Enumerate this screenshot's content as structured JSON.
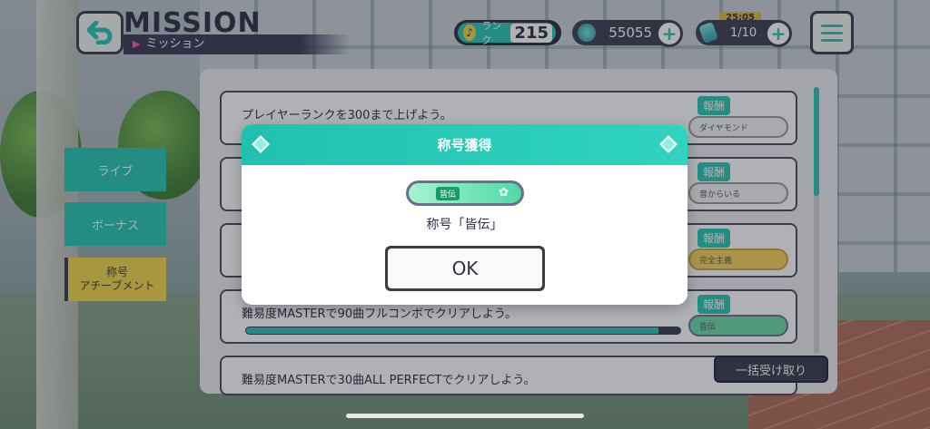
{
  "header": {
    "title": "MISSION",
    "subtitle": "ミッション"
  },
  "status": {
    "rank_label": "ランク",
    "rank_value": "215",
    "gems": "55055",
    "energy": "1/10",
    "energy_timer": "25:05"
  },
  "tabs": [
    {
      "label": "ライブ"
    },
    {
      "label": "ボーナス"
    },
    {
      "label": "称号\nアチーブメント"
    }
  ],
  "missions": [
    {
      "text": "プレイヤーランクを300まで上げよう。",
      "reward_tag": "報酬",
      "reward": "ダイヤモンド"
    },
    {
      "text": "",
      "reward_tag": "報酬",
      "reward": "音からいる"
    },
    {
      "text": "",
      "reward_tag": "報酬",
      "reward": "完全主義"
    },
    {
      "text": "難易度MASTERで90曲フルコンボでクリアしよう。",
      "reward_tag": "報酬",
      "reward": "皆伝",
      "progress": 0.95
    },
    {
      "text": "難易度MASTERで30曲ALL PERFECTでクリアしよう。",
      "reward_tag": "報酬",
      "reward": ""
    }
  ],
  "bulk_receive": "一括受け取り",
  "dialog": {
    "title": "称号獲得",
    "badge_text": "皆伝",
    "message": "称号「皆伝」",
    "ok": "OK"
  },
  "colors": {
    "accent": "#27c7b3",
    "dark": "#3a3c4c",
    "tab_selected": "#f3d84a"
  }
}
